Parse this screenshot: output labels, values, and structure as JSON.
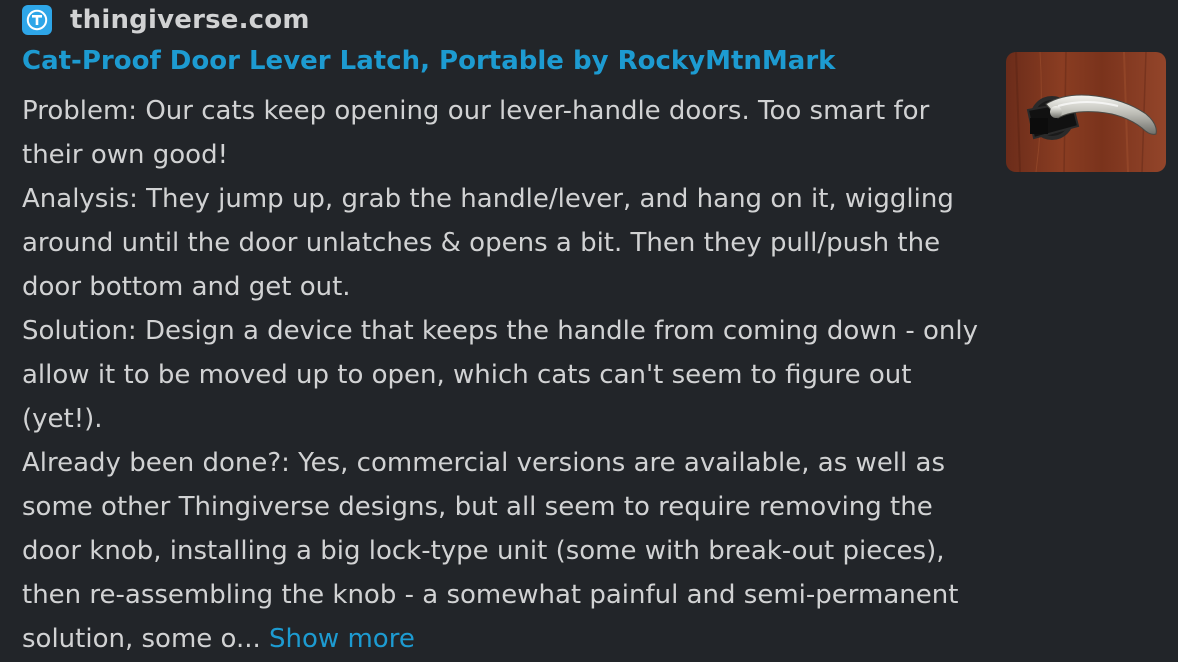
{
  "unfurl": {
    "site_name": "thingiverse.com",
    "site_icon": "thingiverse-logo-icon",
    "title": "Cat-Proof Door Lever Latch, Portable by RockyMtnMark",
    "description_lines": [
      "Problem: Our cats keep opening our lever-handle doors. Too smart for their own good!",
      "Analysis: They jump up, grab the handle/lever, and hang on it, wiggling around until the door unlatches & opens a bit. Then they pull/push the door bottom and get out.",
      "Solution: Design a device that keeps the handle from coming down - only allow it to be moved up to open, which cats can't seem to figure out (yet!).",
      "Already been done?: Yes, commercial versions are available, as well as some other Thingiverse designs, but all seem to require removing the door knob, installing a big lock-type unit (some with break-out pieces), then re-assembling the knob - a somewhat painful and semi-permanent solution, some o..."
    ],
    "show_more_label": "Show more",
    "thumbnail_icon": "door-lever-thumbnail"
  },
  "colors": {
    "background": "#222529",
    "text": "#d1d2d3",
    "link": "#1d9bd1",
    "site_icon_bg": "#2ea6e8"
  }
}
